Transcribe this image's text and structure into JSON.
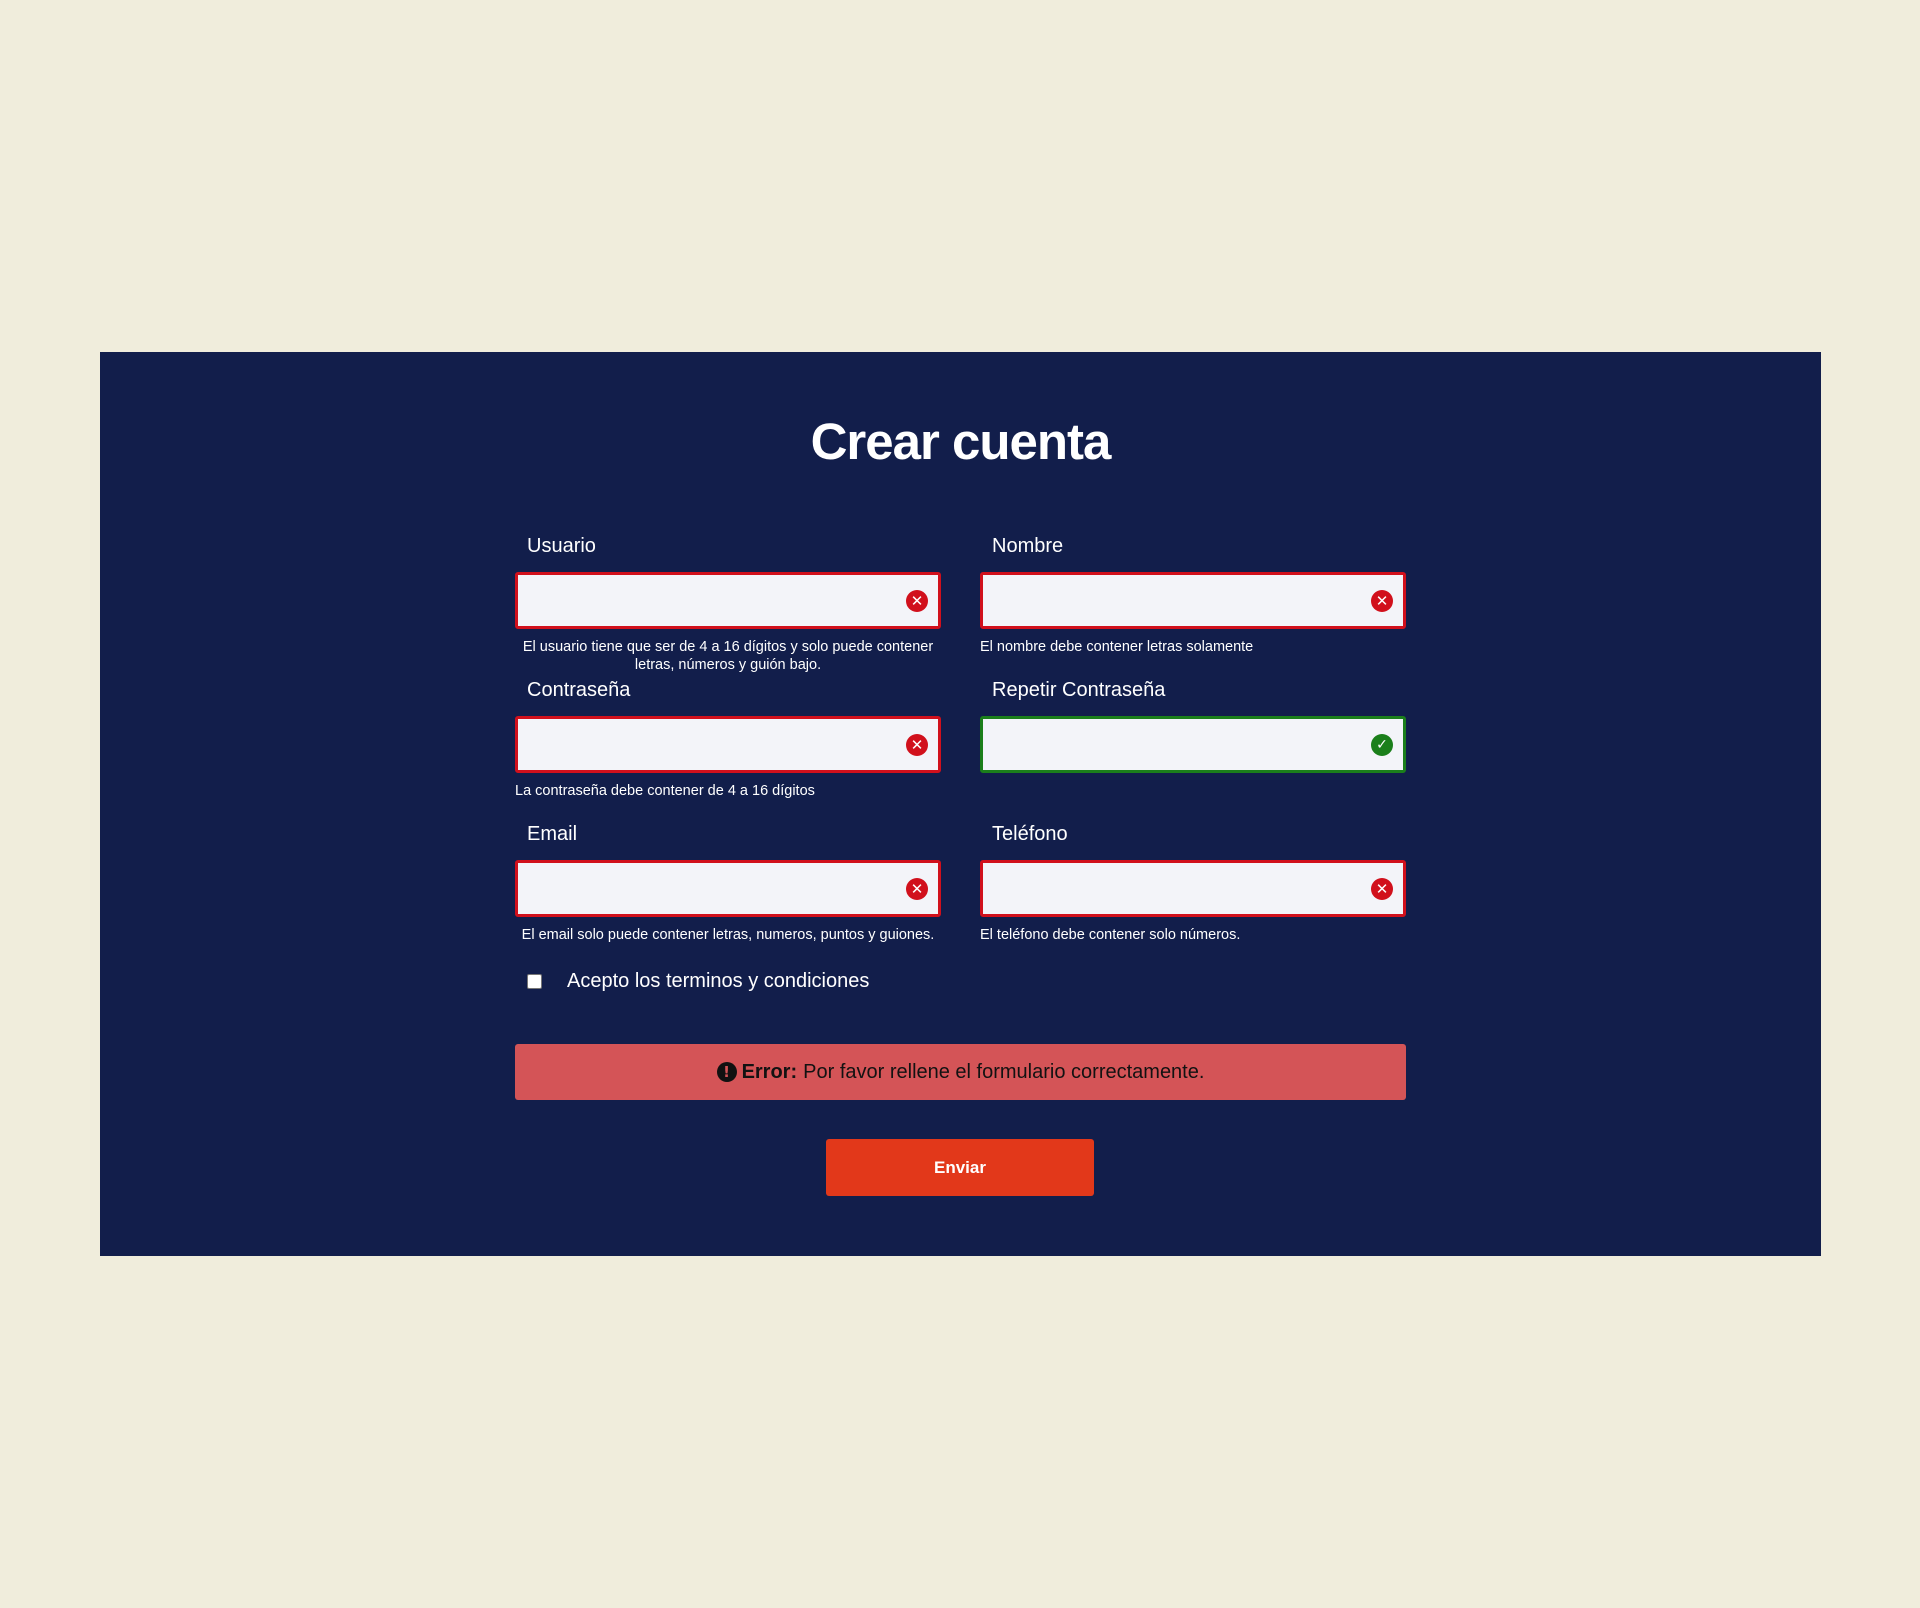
{
  "form": {
    "title": "Crear cuenta",
    "fields": {
      "usuario": {
        "label": "Usuario",
        "value": "",
        "status": "error",
        "status_icon": "error-icon",
        "hint": "El usuario tiene que ser de 4 a 16 dígitos y solo puede contener letras, números y guión bajo."
      },
      "nombre": {
        "label": "Nombre",
        "value": "",
        "status": "error",
        "status_icon": "error-icon",
        "hint": "El nombre debe contener letras solamente"
      },
      "password": {
        "label": "Contraseña",
        "value": "",
        "status": "error",
        "status_icon": "error-icon",
        "hint": "La contraseña debe contener de 4 a 16 dígitos"
      },
      "password2": {
        "label": "Repetir Contraseña",
        "value": "",
        "status": "valid",
        "status_icon": "check-icon"
      },
      "email": {
        "label": "Email",
        "value": "",
        "status": "error",
        "status_icon": "error-icon",
        "hint": "El email solo puede contener letras, numeros, puntos y guiones."
      },
      "telefono": {
        "label": "Teléfono",
        "value": "",
        "status": "error",
        "status_icon": "error-icon",
        "hint": "El teléfono debe contener solo números."
      }
    },
    "terms": {
      "label": "Acepto los terminos y condiciones",
      "checked": false
    },
    "alert": {
      "icon": "exclamation-circle-icon",
      "strong": "Error:",
      "message": "Por favor rellene el formulario correctamente."
    },
    "submit_label": "Enviar"
  },
  "colors": {
    "page_background": "#f0eddc",
    "panel_background": "#121e4b",
    "error_border": "#d1101c",
    "valid_border": "#1b7f1b",
    "alert_background": "#d45457",
    "button_background": "#e2381a"
  }
}
